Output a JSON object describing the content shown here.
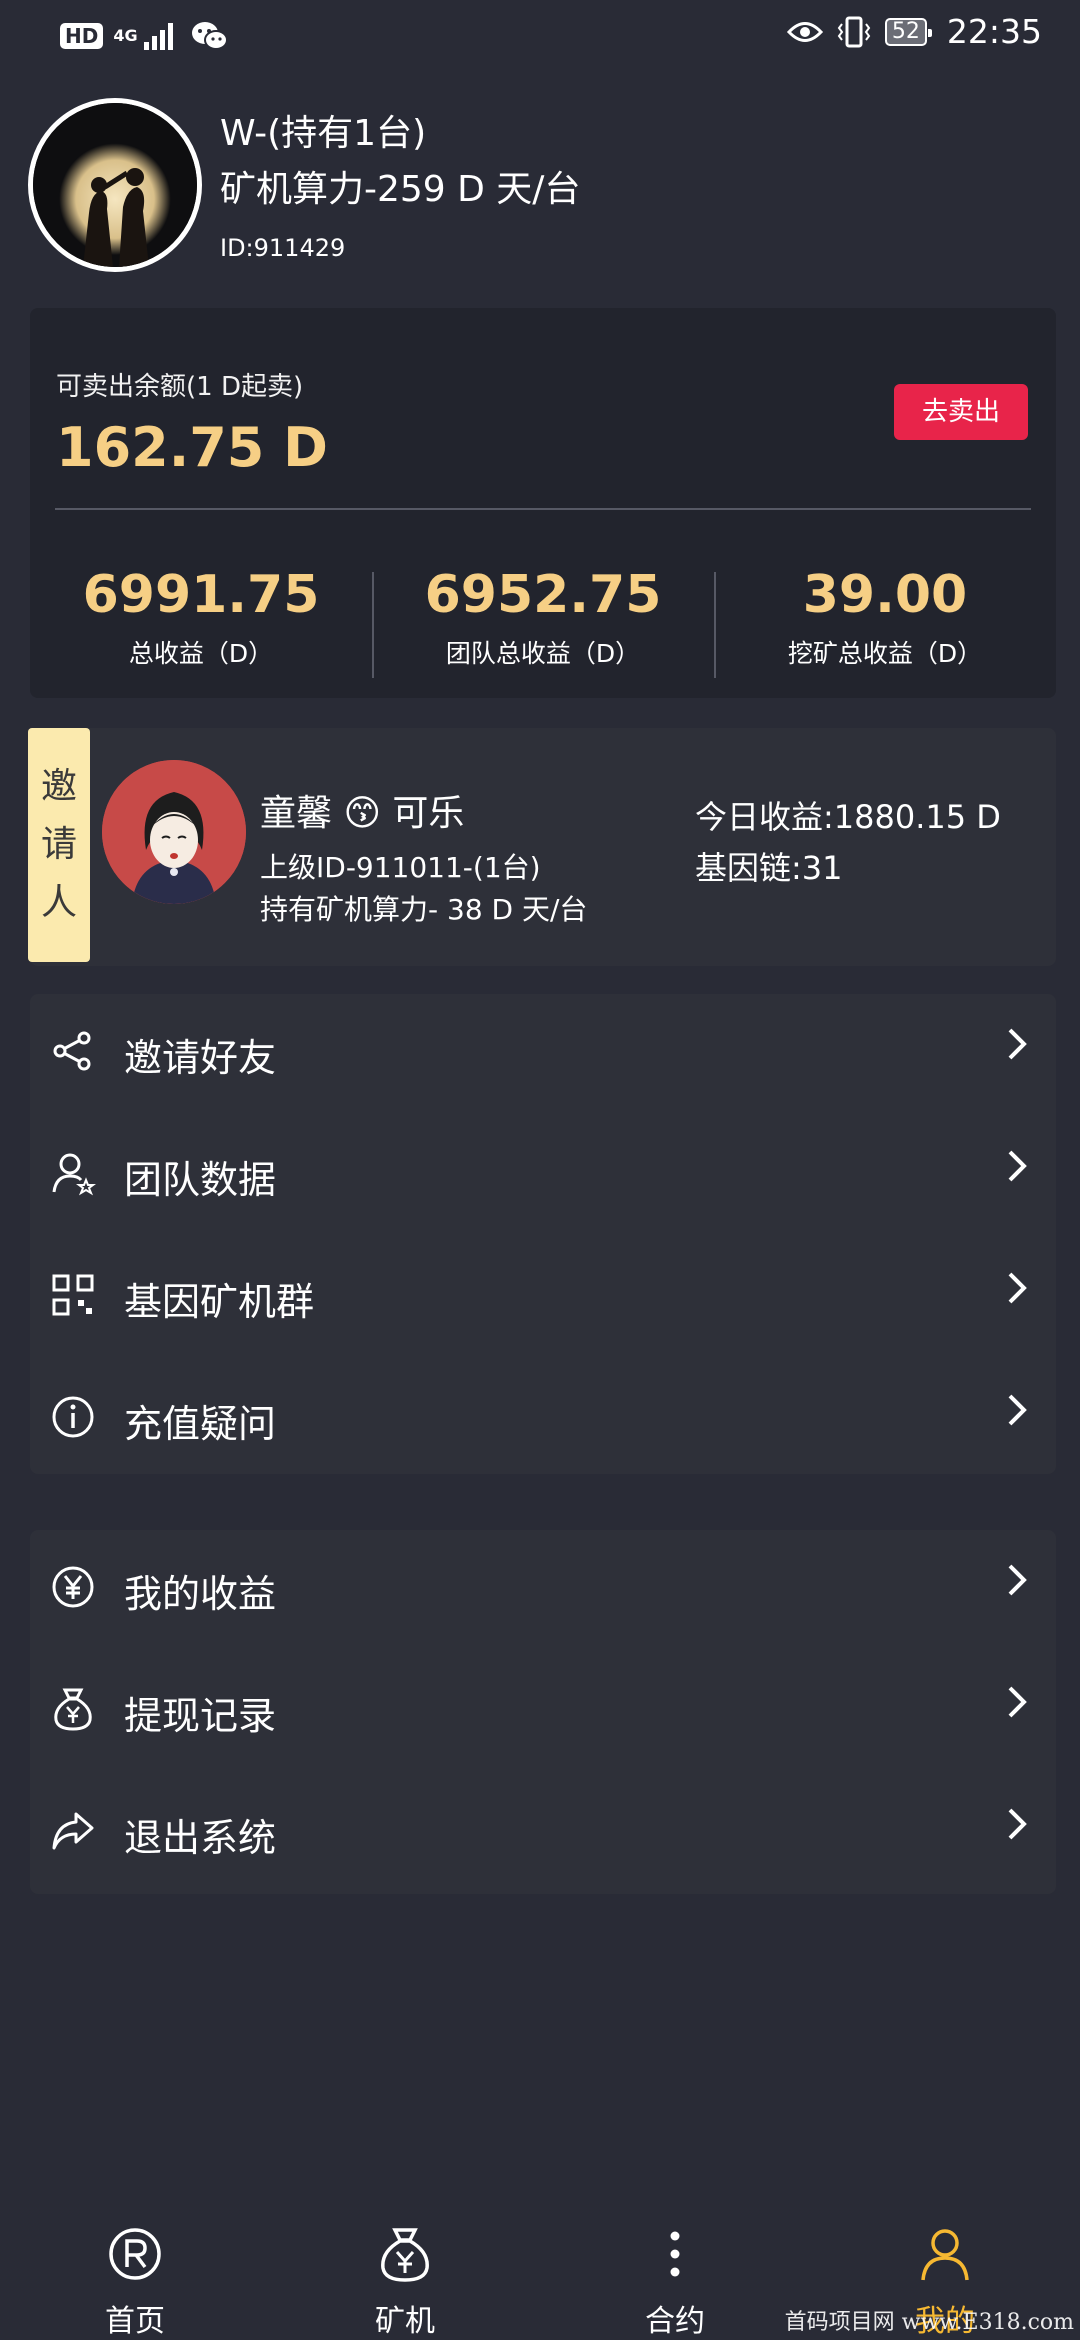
{
  "status_bar": {
    "hd": "HD",
    "network": "4G",
    "battery": "52",
    "time": "22:35"
  },
  "profile": {
    "name": "W-(持有1台)",
    "power": "矿机算力-259 D 天/台",
    "id": "ID:911429"
  },
  "balance": {
    "label": "可卖出余额(1 D起卖)",
    "value": "162.75 D",
    "sell_button": "去卖出",
    "stats": [
      {
        "value": "6991.75",
        "label": "总收益（D）"
      },
      {
        "value": "6952.75",
        "label": "团队总收益（D）"
      },
      {
        "value": "39.00",
        "label": "挖矿总收益（D）"
      }
    ]
  },
  "inviter": {
    "badge": [
      "邀",
      "请",
      "人"
    ],
    "name": "童馨 😙 可乐",
    "superior": "上级ID-911011-(1台)",
    "power": "持有矿机算力- 38 D 天/台",
    "today_income": "今日收益:1880.15 D",
    "gene_chain": "基因链:31"
  },
  "menu_group_1": [
    {
      "label": "邀请好友",
      "icon": "share-icon"
    },
    {
      "label": "团队数据",
      "icon": "user-star-icon"
    },
    {
      "label": "基因矿机群",
      "icon": "grid-icon"
    },
    {
      "label": "充值疑问",
      "icon": "info-icon"
    }
  ],
  "menu_group_2": [
    {
      "label": "我的收益",
      "icon": "yen-circle-icon"
    },
    {
      "label": "提现记录",
      "icon": "money-bag-icon"
    },
    {
      "label": "退出系统",
      "icon": "exit-arrow-icon"
    }
  ],
  "tabbar": [
    {
      "label": "首页",
      "icon": "registered-icon"
    },
    {
      "label": "矿机",
      "icon": "money-bag-icon"
    },
    {
      "label": "合约",
      "icon": "more-vertical-icon"
    },
    {
      "label": "我的",
      "icon": "user-icon",
      "active": true
    }
  ],
  "watermark": "首码项目网 www.E318.com",
  "colors": {
    "background": "#292b36",
    "card": "#2e3039",
    "accent_gold": "#f6cf85",
    "sell_red": "#e8244a",
    "tab_active": "#f6b832",
    "badge_yellow": "#fbeaae"
  }
}
